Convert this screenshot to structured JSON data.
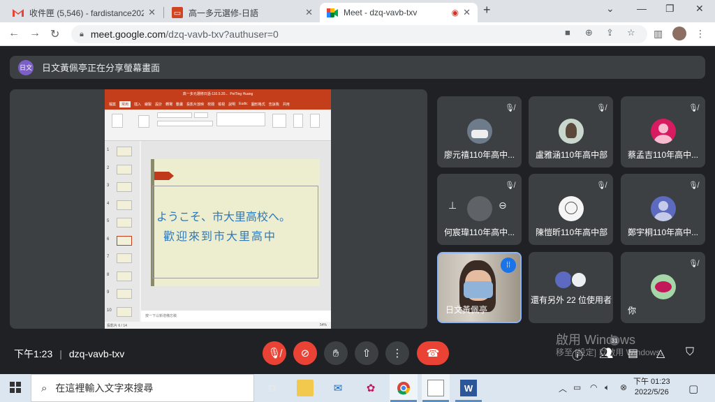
{
  "tabs": [
    {
      "title": "收件匣 (5,546) - fardistance202",
      "favicon": "gmail-icon",
      "active": false
    },
    {
      "title": "高一多元選修-日語",
      "favicon": "slides-icon",
      "active": false
    },
    {
      "title": "Meet - dzq-vavb-txv",
      "favicon": "meet-icon",
      "active": true
    }
  ],
  "address": {
    "host": "meet.google.com",
    "path": "/dzq-vavb-txv?authuser=0"
  },
  "banner": {
    "avatar_text": "日文",
    "text": "日文黃佩亭正在分享螢幕畫面"
  },
  "presentation": {
    "window_title": "高一多元選修日語-110.5.20...",
    "user": "PeiTing Huang",
    "menu": [
      "檔案",
      "常用",
      "插入",
      "繪製",
      "設計",
      "轉場",
      "動畫",
      "投影片放映",
      "校閱",
      "檢視",
      "說明",
      "Eudic",
      "圖形格式",
      "告訴我",
      "共用"
    ],
    "slide_line1": "ようこそ、市大里高校へ。",
    "slide_line2": "歡迎來到市大里高中",
    "notes_placeholder": "按一下以新增備忘稿",
    "status_left": "投影片 6 / 14",
    "zoom": "54%",
    "thumb_numbers": [
      "1",
      "2",
      "3",
      "4",
      "5",
      "6",
      "7",
      "8",
      "9",
      "10"
    ]
  },
  "participants": [
    {
      "name": "廖元禧110年高中...",
      "muted": true,
      "avatar": "car-photo"
    },
    {
      "name": "盧雅涵110年高中部",
      "muted": true,
      "avatar": "anime-photo"
    },
    {
      "name": "蔡孟吉110年高中...",
      "muted": true,
      "avatar": "default-pink"
    },
    {
      "name": "何宸瑋110年高中...",
      "muted": true,
      "avatar": "hover-controls"
    },
    {
      "name": "陳愷昕110年高中部",
      "muted": true,
      "avatar": "sketch-photo"
    },
    {
      "name": "鄭宇桐110年高中...",
      "muted": true,
      "avatar": "default-blue"
    },
    {
      "name": "日文黃佩亭",
      "muted": false,
      "avatar": "video"
    },
    {
      "name": "還有另外 22 位使用者",
      "muted": false,
      "avatar": "group"
    },
    {
      "name": "你",
      "muted": true,
      "avatar": "self-photo"
    }
  ],
  "meeting": {
    "time": "下午1:23",
    "code": "dzq-vavb-txv",
    "people_count": "31"
  },
  "watermark": {
    "line1": "啟用 Windows",
    "line2": "移至 [設定] 以啟用 Windows。"
  },
  "taskbar": {
    "search_placeholder": "在這裡輸入文字來搜尋",
    "clock_time": "下午 01:23",
    "clock_date": "2022/5/26"
  },
  "colors": {
    "meet_bg": "#202124",
    "tile_bg": "#3c4043",
    "red": "#ea4335",
    "speaking": "#8ab4f8"
  }
}
